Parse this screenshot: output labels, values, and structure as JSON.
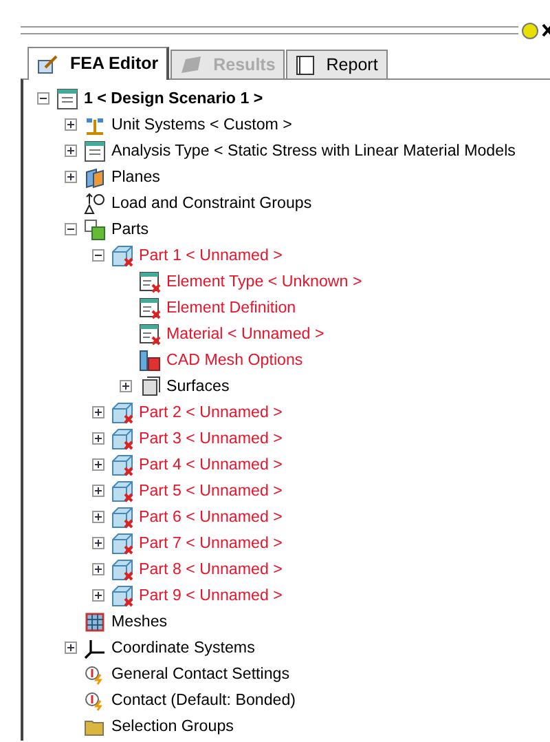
{
  "tabs": [
    {
      "label": "FEA Editor",
      "selected": true,
      "disabled": false
    },
    {
      "label": "Results",
      "selected": false,
      "disabled": true
    },
    {
      "label": "Report",
      "selected": false,
      "disabled": false
    }
  ],
  "tree": [
    {
      "label": "1 < Design Scenario 1 >",
      "kind": "scenario",
      "error": false,
      "expanded": true,
      "children": [
        {
          "label": "Unit Systems < Custom >",
          "kind": "units",
          "error": false,
          "expanded": false
        },
        {
          "label": "Analysis Type < Static Stress with Linear Material Models",
          "kind": "scenario",
          "error": false,
          "expanded": false
        },
        {
          "label": "Planes",
          "kind": "planes",
          "error": false,
          "expanded": false
        },
        {
          "label": "Load and Constraint Groups",
          "kind": "load",
          "error": false
        },
        {
          "label": "Parts",
          "kind": "parts",
          "error": false,
          "expanded": true,
          "children": [
            {
              "label": "Part 1 < Unnamed >",
              "kind": "part",
              "error": true,
              "expanded": true,
              "children": [
                {
                  "label": "Element Type < Unknown >",
                  "kind": "element",
                  "error": true
                },
                {
                  "label": "Element Definition",
                  "kind": "element",
                  "error": true
                },
                {
                  "label": "Material < Unnamed >",
                  "kind": "element",
                  "error": true
                },
                {
                  "label": "CAD Mesh Options",
                  "kind": "mesh-options",
                  "error": true
                },
                {
                  "label": "Surfaces",
                  "kind": "surfaces",
                  "error": false,
                  "expanded": false
                }
              ]
            },
            {
              "label": "Part 2 < Unnamed >",
              "kind": "part",
              "error": true,
              "expanded": false
            },
            {
              "label": "Part 3 < Unnamed >",
              "kind": "part",
              "error": true,
              "expanded": false
            },
            {
              "label": "Part 4 < Unnamed >",
              "kind": "part",
              "error": true,
              "expanded": false
            },
            {
              "label": "Part 5 < Unnamed >",
              "kind": "part",
              "error": true,
              "expanded": false
            },
            {
              "label": "Part 6 < Unnamed >",
              "kind": "part",
              "error": true,
              "expanded": false
            },
            {
              "label": "Part 7 < Unnamed >",
              "kind": "part",
              "error": true,
              "expanded": false
            },
            {
              "label": "Part 8 < Unnamed >",
              "kind": "part",
              "error": true,
              "expanded": false
            },
            {
              "label": "Part 9 < Unnamed >",
              "kind": "part",
              "error": true,
              "expanded": false
            }
          ]
        },
        {
          "label": "Meshes",
          "kind": "meshes",
          "error": false
        },
        {
          "label": "Coordinate Systems",
          "kind": "coords",
          "error": false,
          "expanded": false
        },
        {
          "label": "General Contact Settings",
          "kind": "contact",
          "error": false
        },
        {
          "label": "Contact (Default: Bonded)",
          "kind": "contact",
          "error": false
        },
        {
          "label": "Selection Groups",
          "kind": "folder",
          "error": false
        }
      ]
    }
  ]
}
